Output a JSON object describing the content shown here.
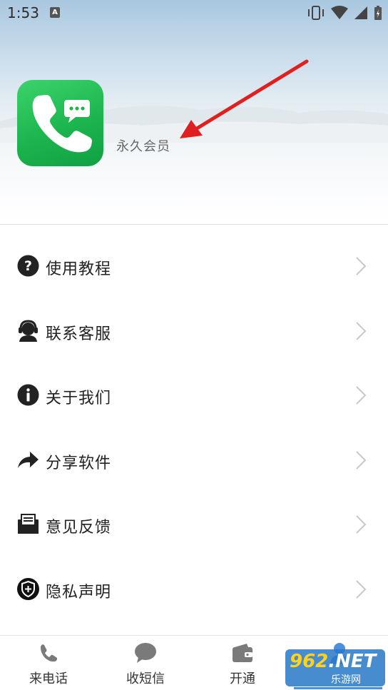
{
  "status_bar": {
    "time": "1:53",
    "notification_letter": "A"
  },
  "profile": {
    "member_label": "永久会员"
  },
  "menu": {
    "items": [
      {
        "label": "使用教程",
        "icon": "help-circle-icon"
      },
      {
        "label": "联系客服",
        "icon": "customer-service-icon"
      },
      {
        "label": "关于我们",
        "icon": "info-circle-icon"
      },
      {
        "label": "分享软件",
        "icon": "share-arrow-icon"
      },
      {
        "label": "意见反馈",
        "icon": "feedback-mail-icon"
      },
      {
        "label": "隐私声明",
        "icon": "privacy-shield-icon"
      }
    ]
  },
  "bottom_nav": {
    "tabs": [
      {
        "label": "来电话",
        "icon": "phone-icon"
      },
      {
        "label": "收短信",
        "icon": "message-bubble-icon"
      },
      {
        "label": "开通",
        "icon": "wallet-icon"
      },
      {
        "label": "",
        "icon": "user-icon"
      }
    ],
    "active_index": 3
  },
  "watermark": {
    "num": "962",
    "suffix": ".NET",
    "sub": "乐游网"
  },
  "colors": {
    "app_icon_green": "#1db54f",
    "annotation_arrow": "#e02020",
    "active_tab_blue": "#4a8fe0"
  }
}
